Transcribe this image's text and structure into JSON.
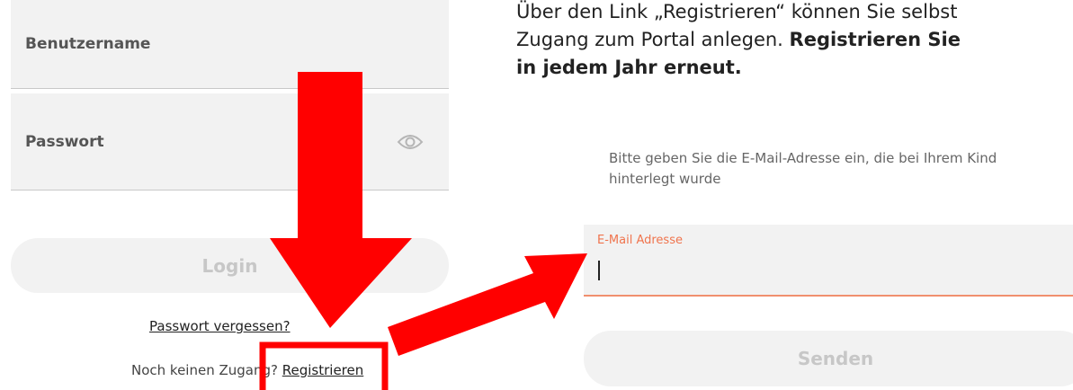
{
  "login": {
    "username_placeholder": "Benutzername",
    "password_placeholder": "Passwort",
    "login_label": "Login",
    "forgot_password": "Passwort vergessen?",
    "no_access_text": "Noch keinen Zugang?",
    "register_link": "Registrieren"
  },
  "instruction": {
    "line1": "Über den Link „Registrieren“ können Sie selbst",
    "line2_normal": "Zugang zum Portal anlegen. ",
    "line2_bold": "Registrieren Sie",
    "line3_bold": "in jedem Jahr erneut."
  },
  "registration": {
    "hint": "Bitte geben Sie die E-Mail-Adresse ein, die bei Ihrem Kind hinterlegt wurde",
    "email_label": "E-Mail Adresse",
    "email_value": "",
    "send_label": "Senden"
  },
  "colors": {
    "annotation_red": "#ff0000",
    "accent_orange": "#f0744d"
  },
  "icons": {
    "password_toggle": "eye-icon"
  }
}
